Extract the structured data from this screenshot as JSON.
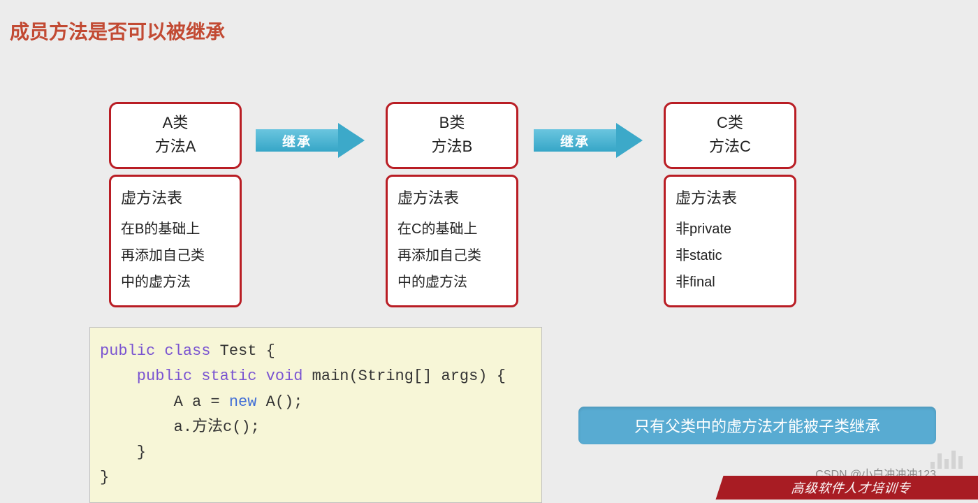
{
  "title": "成员方法是否可以被继承",
  "arrows": {
    "label": "继承"
  },
  "classes": {
    "a": {
      "name": "A类",
      "method": "方法A",
      "vtable_title": "虚方法表",
      "line1": "在B的基础上",
      "line2": "再添加自己类",
      "line3": "中的虚方法"
    },
    "b": {
      "name": "B类",
      "method": "方法B",
      "vtable_title": "虚方法表",
      "line1": "在C的基础上",
      "line2": "再添加自己类",
      "line3": "中的虚方法"
    },
    "c": {
      "name": "C类",
      "method": "方法C",
      "vtable_title": "虚方法表",
      "line1": "非private",
      "line2": "非static",
      "line3": "非final"
    }
  },
  "code": {
    "l1a": "public",
    "l1b": " class",
    "l1c": " Test {",
    "l2a": "    public",
    "l2b": " static",
    "l2c": " void",
    "l2d": " main(String[] args) {",
    "l3a": "        A a = ",
    "l3b": "new",
    "l3c": " A();",
    "l4": "        a.方法c();",
    "l5": "    }",
    "l6": "}"
  },
  "callout": "只有父类中的虚方法才能被子类继承",
  "watermark": "CSDN @小白冲冲冲123",
  "ribbon": "高级软件人才培训专"
}
